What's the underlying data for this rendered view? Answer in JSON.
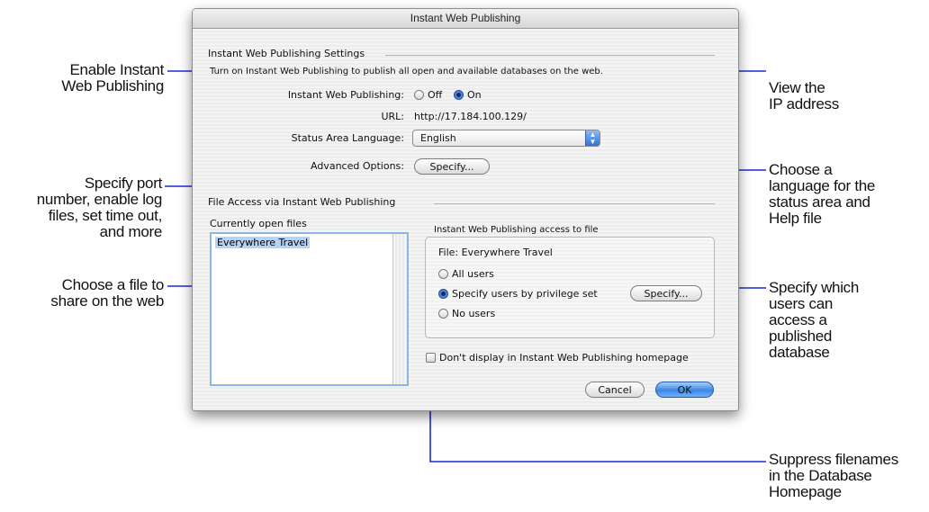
{
  "window": {
    "title": "Instant Web Publishing"
  },
  "settings": {
    "group_label": "Instant Web Publishing Settings",
    "description": "Turn on Instant Web Publishing to publish all open and available databases on the web.",
    "iwp_label": "Instant Web Publishing:",
    "off_label": "Off",
    "on_label": "On",
    "url_label": "URL:",
    "url_value": "http://17.184.100.129/",
    "language_label": "Status Area Language:",
    "language_value": "English",
    "advanced_label": "Advanced Options:",
    "specify_label": "Specify..."
  },
  "file_access": {
    "group_label": "File Access via Instant Web Publishing",
    "open_files_label": "Currently open files",
    "files": [
      "Everywhere Travel"
    ],
    "access_label": "Instant Web Publishing access to file",
    "file_line": "File: Everywhere Travel",
    "all_users": "All users",
    "by_privilege": "Specify users by privilege set",
    "no_users": "No users",
    "specify_label": "Specify...",
    "dont_display": "Don't display in Instant Web Publishing homepage"
  },
  "buttons": {
    "cancel": "Cancel",
    "ok": "OK"
  },
  "callouts": {
    "enable": [
      "Enable Instant",
      "Web Publishing"
    ],
    "specify_port": [
      "Specify port",
      "number, enable log",
      "files, set time out,",
      "and more"
    ],
    "choose_file": [
      "Choose a file to",
      "share on the web"
    ],
    "view_ip": [
      "View the",
      "IP address"
    ],
    "choose_language": [
      "Choose a",
      "language for the",
      "status area and",
      "Help file"
    ],
    "specify_users": [
      "Specify which",
      "users can",
      "access a",
      "published",
      "database"
    ],
    "suppress": [
      "Suppress filenames",
      "in the Database",
      "Homepage"
    ]
  },
  "colors": {
    "leader": "#1a2bd6",
    "selection": "#b6d3f5",
    "default_button": "#3d86e6"
  }
}
